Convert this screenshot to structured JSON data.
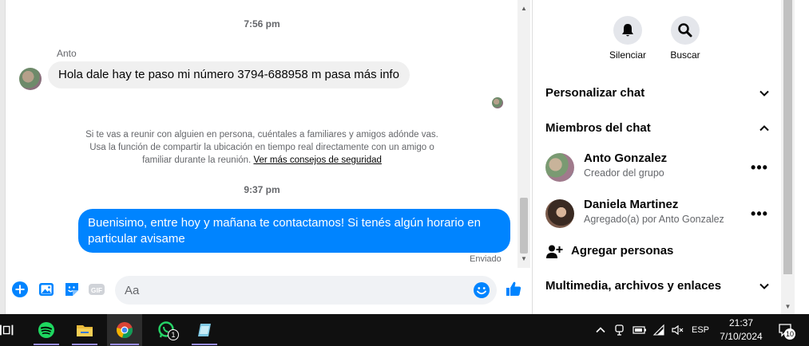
{
  "chat": {
    "time_1": "7:56 pm",
    "sender_name": "Anto",
    "incoming_message": "Hola dale hay te paso mi número 3794-688958 m pasa más info",
    "safety_text": "Si te vas a reunir con alguien en persona, cuéntales a familiares y amigos adónde vas. Usa la función de compartir la ubicación en tiempo real directamente con un amigo o familiar durante la reunión.",
    "safety_link": "Ver más consejos de seguridad",
    "time_2": "9:37 pm",
    "outgoing_message": "Buenisimo, entre hoy y mañana te contactamos! Si tenés algún horario en particular avisame",
    "sent_status": "Enviado"
  },
  "composer": {
    "placeholder": "Aa",
    "icons": [
      "plus-icon",
      "image-icon",
      "sticker-icon",
      "gif-icon",
      "emoji-icon",
      "like-icon"
    ],
    "gif_label": "GIF"
  },
  "panel": {
    "actions": [
      {
        "label": "Silenciar",
        "icon": "bell-icon"
      },
      {
        "label": "Buscar",
        "icon": "search-icon"
      }
    ],
    "sections": {
      "customize": "Personalizar chat",
      "members": "Miembros del chat",
      "media": "Multimedia, archivos y enlaces"
    },
    "members": [
      {
        "name": "Anto Gonzalez",
        "role": "Creador del grupo"
      },
      {
        "name": "Daniela Martinez",
        "role": "Agregado(a) por Anto Gonzalez"
      }
    ],
    "add_people": "Agregar personas"
  },
  "taskbar": {
    "language": "ESP",
    "time": "21:37",
    "date": "7/10/2024",
    "whatsapp_badge": "1",
    "notifications_count": "10"
  },
  "colors": {
    "messenger_blue": "#0084ff",
    "incoming_bubble": "#f0f0f0",
    "taskbar": "#101010"
  }
}
